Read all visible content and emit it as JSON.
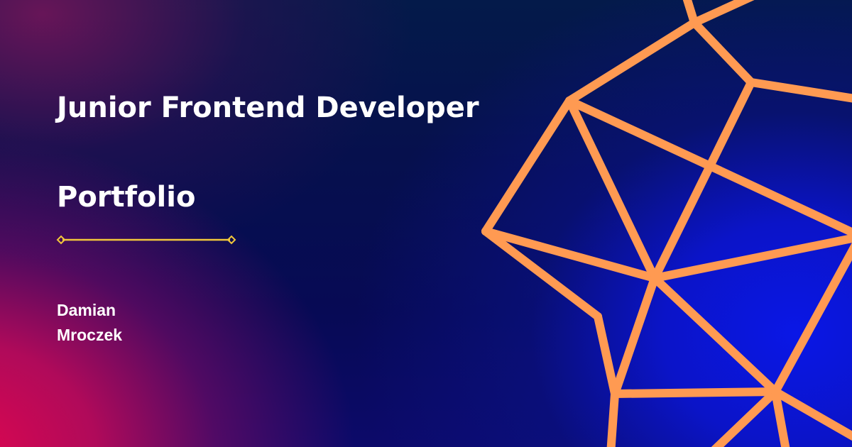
{
  "card": {
    "title": "Junior Frontend Developer",
    "subtitle": "Portfolio",
    "author": {
      "first_name": "Damian",
      "last_name": "Mroczek"
    }
  },
  "colors": {
    "background_dark": "#070a55",
    "background_pink": "#e0064f",
    "background_blue": "#0a17e6",
    "mesh_stroke": "#ff9a52",
    "divider": "#f2c83b",
    "text": "#ffffff"
  },
  "icons": {
    "divider_ends": "diamond-icon"
  }
}
